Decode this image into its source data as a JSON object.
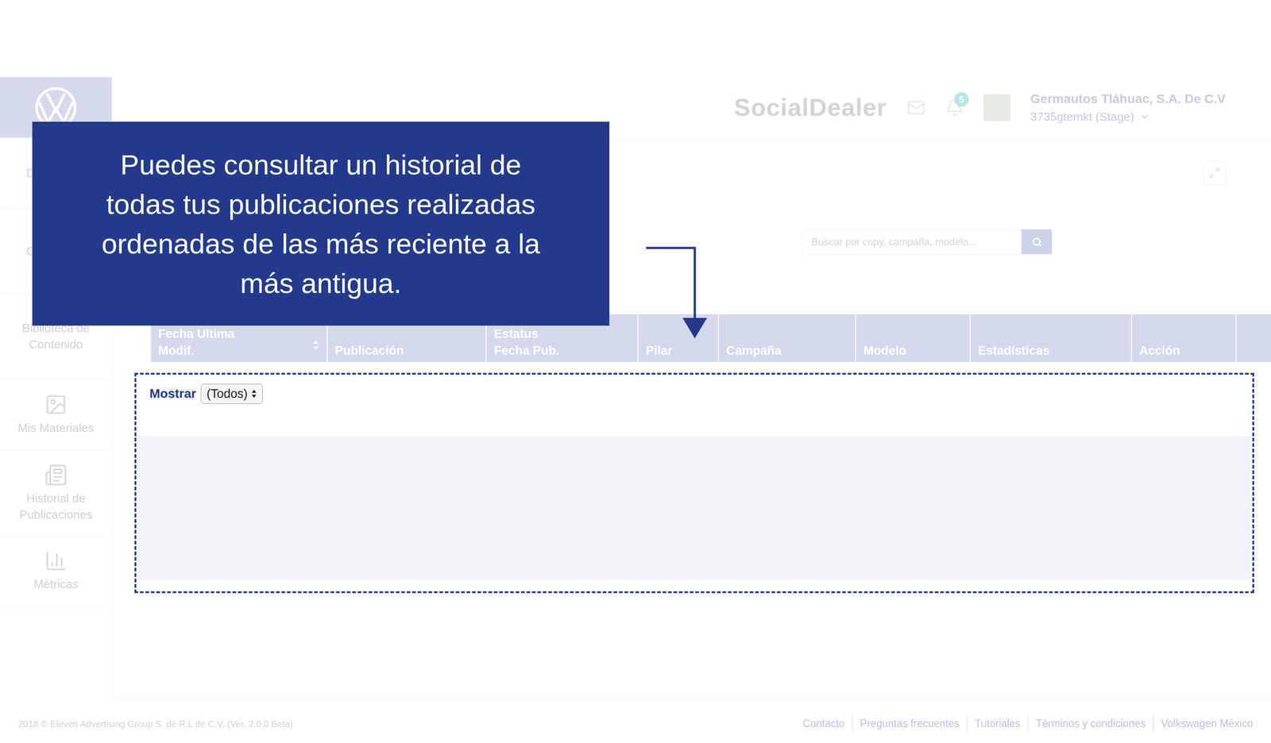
{
  "header": {
    "brand": "SocialDealer",
    "notification_badge": "5",
    "company": "Germautos Tláhuac, S.A. De C.V",
    "account": "3735gtemkt (Stage)"
  },
  "sidebar": {
    "items": [
      {
        "label": "D",
        "kind": "clipped"
      },
      {
        "label": "C",
        "kind": "clipped"
      },
      {
        "label": "Biblioteca de Contenido",
        "kind": "plain"
      },
      {
        "label": "Mis Materiales",
        "kind": "image"
      },
      {
        "label": "Historial de Publicaciones",
        "kind": "news"
      },
      {
        "label": "Métricas",
        "kind": "chart"
      }
    ]
  },
  "callout": {
    "lines": [
      "Puedes consultar un historial de",
      "todas tus publicaciones realizadas",
      "ordenadas de las más reciente a la",
      "más antigua."
    ]
  },
  "search": {
    "placeholder": "Buscar por copy, campaña, modelo..."
  },
  "table": {
    "columns": [
      {
        "lines": [
          "Fecha Ultima",
          "Modif."
        ],
        "sortable": true
      },
      {
        "lines": [
          "Publicación"
        ],
        "sortable": false
      },
      {
        "lines": [
          "Estatus",
          "Fecha Pub."
        ],
        "sortable": false
      },
      {
        "lines": [
          "Pilar"
        ],
        "sortable": false
      },
      {
        "lines": [
          "Campaña"
        ],
        "sortable": false
      },
      {
        "lines": [
          "Modelo"
        ],
        "sortable": false
      },
      {
        "lines": [
          "Estadísticas"
        ],
        "sortable": false
      },
      {
        "lines": [
          "Acción"
        ],
        "sortable": false
      }
    ]
  },
  "filter": {
    "label": "Mostrar",
    "value": "(Todos)"
  },
  "footer": {
    "copyright": "2018 © Eleven Advertising Group S. de R.L de C.V. (Ver. 2.0.0 Beta)",
    "links": [
      "Contacto",
      "Preguntas frecuentes",
      "Tutoriales",
      "Términos y condiciones",
      "Volkswagen México"
    ]
  }
}
